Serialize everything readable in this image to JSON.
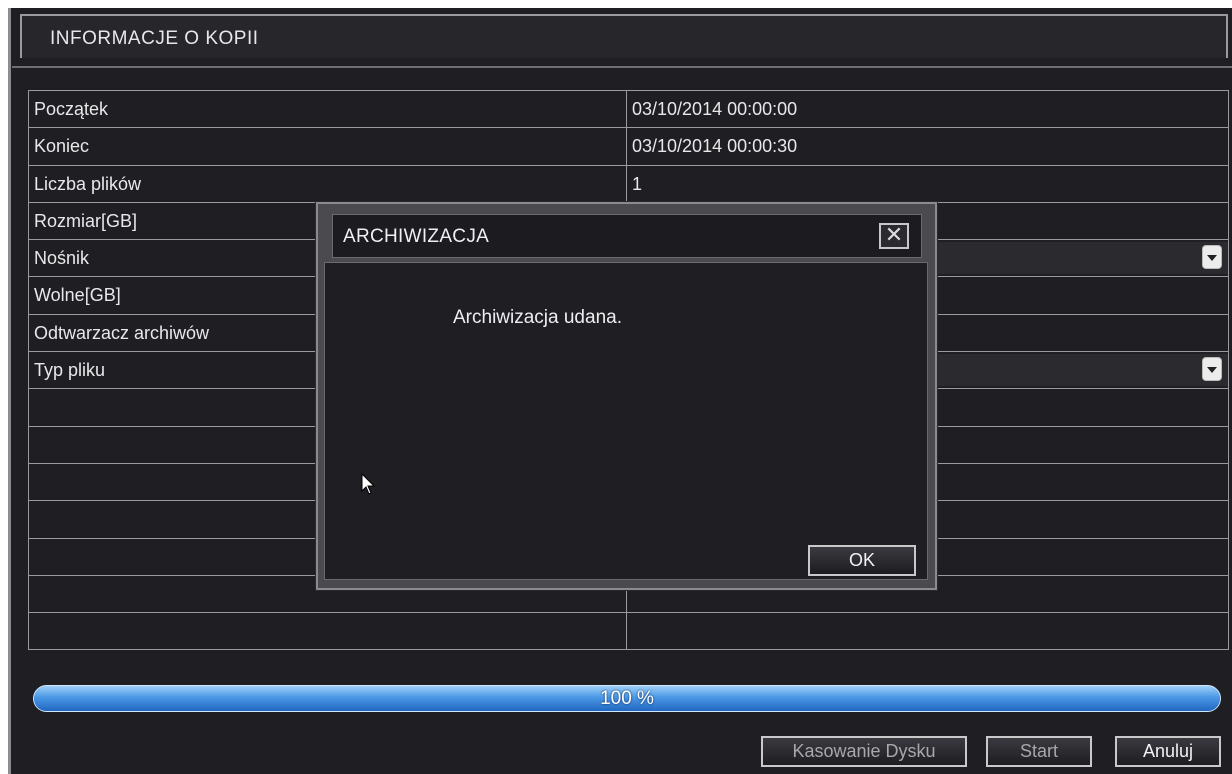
{
  "window": {
    "title": "INFORMACJE O KOPII"
  },
  "table": {
    "rows": [
      {
        "label": "Początek",
        "value": "03/10/2014 00:00:00"
      },
      {
        "label": "Koniec",
        "value": "03/10/2014 00:00:30"
      },
      {
        "label": "Liczba plików",
        "value": "1"
      },
      {
        "label": "Rozmiar[GB]",
        "value": ""
      },
      {
        "label": "Nośnik",
        "value": ""
      },
      {
        "label": "Wolne[GB]",
        "value": ""
      },
      {
        "label": "Odtwarzacz archiwów",
        "value": ""
      },
      {
        "label": "Typ pliku",
        "value": ""
      }
    ],
    "empty_row_count": 7
  },
  "progress": {
    "label": "100 %",
    "percent": 100
  },
  "buttons": {
    "erase": "Kasowanie Dysku",
    "start": "Start",
    "cancel": "Anuluj"
  },
  "dialog": {
    "title": "ARCHIWIZACJA",
    "close_icon": "close-icon",
    "message": "Archiwizacja udana.",
    "ok": "OK"
  },
  "colors": {
    "background": "#1f1f23",
    "progress": "#3e8ee0",
    "dialog_frame": "#4a4a4f"
  }
}
